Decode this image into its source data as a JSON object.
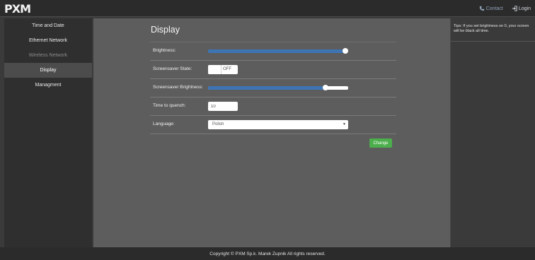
{
  "header": {
    "logo_text": "PXM",
    "contact_label": "Contact",
    "login_label": "Login",
    "contact_icon": "phone-icon",
    "login_icon": "login-icon"
  },
  "sidebar": {
    "items": [
      {
        "label": "Time and Date",
        "state": "normal"
      },
      {
        "label": "Ethernet Network",
        "state": "normal"
      },
      {
        "label": "Wireless Network",
        "state": "disabled"
      },
      {
        "label": "Display",
        "state": "active"
      },
      {
        "label": "Managment",
        "state": "normal"
      }
    ]
  },
  "main": {
    "title": "Display",
    "brightness": {
      "label": "Brightness:",
      "value": 1.0
    },
    "screensaver_state": {
      "label": "Screensaver State:",
      "value": "OFF"
    },
    "screensaver_brightness": {
      "label": "Screensaver Brightness:",
      "value": 0.85
    },
    "time_to_quench": {
      "label": "Time to quench:",
      "value": "10"
    },
    "language": {
      "label": "Language:",
      "value": "Polish"
    },
    "change_label": "Change"
  },
  "tips": {
    "text": "Tips: If you set brightness on 0, your screen will be black all time."
  },
  "footer": {
    "copyright": "Copyright © PXM Sp.k. Marek Zupnik All rights reserved."
  },
  "colors": {
    "slider_fill": "#3d74b4",
    "button_green": "#4cae4c",
    "main_bg": "#5d5d5d",
    "sidebar_bg": "#2f2f2f",
    "topbar_bg": "#2b2b2b"
  }
}
